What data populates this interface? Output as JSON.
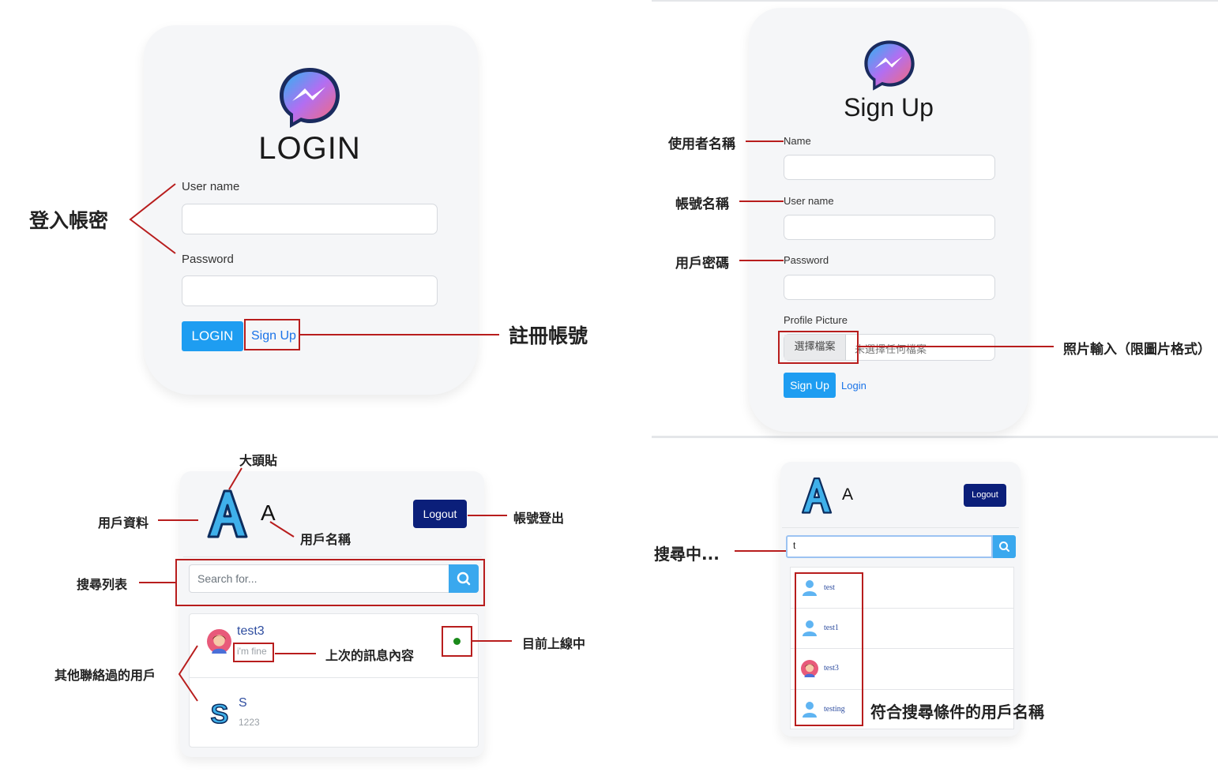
{
  "login": {
    "title": "LOGIN",
    "username_label": "User name",
    "password_label": "Password",
    "login_button": "LOGIN",
    "signup_link": "Sign Up"
  },
  "signup": {
    "title": "Sign Up",
    "name_label": "Name",
    "username_label": "User name",
    "password_label": "Password",
    "picture_label": "Profile Picture",
    "file_button": "選擇檔案",
    "file_status": "未選擇任何檔案",
    "signup_button": "Sign Up",
    "login_link": "Login"
  },
  "chat": {
    "avatar_letter": "A",
    "user_name": "A",
    "logout_button": "Logout",
    "search_placeholder": "Search for...",
    "contacts": [
      {
        "name": "test3",
        "last_message": "i'm fine",
        "avatar": "female-avatar"
      },
      {
        "name": "S",
        "last_message": "1223",
        "avatar": "letter-s"
      }
    ],
    "online_color": "#1a8a1a"
  },
  "search": {
    "avatar_letter": "A",
    "user_name": "A",
    "logout_button": "Logout",
    "query": "t",
    "results": [
      {
        "name": "test",
        "avatar": "person-icon"
      },
      {
        "name": "test1",
        "avatar": "person-icon"
      },
      {
        "name": "test3",
        "avatar": "female-avatar"
      },
      {
        "name": "testing",
        "avatar": "person-icon"
      }
    ]
  },
  "annotations": {
    "login_account": "登入帳密",
    "register_account": "註冊帳號",
    "username_name": "使用者名稱",
    "account_name": "帳號名稱",
    "user_password": "用戶密碼",
    "photo_input": "照片輸入（限圖片格式）",
    "profile_picture": "大頭貼",
    "user_profile": "用戶資料",
    "user_name": "用戶名稱",
    "logout": "帳號登出",
    "search_list": "搜尋列表",
    "last_message": "上次的訊息內容",
    "online_now": "目前上線中",
    "other_contacts": "其他聯絡過的用戶",
    "searching": "搜尋中...",
    "matching_users": "符合搜尋條件的用戶名稱"
  },
  "colors": {
    "primary_blue": "#1e9df1",
    "navy": "#0b1f7a",
    "annotation_red": "#b81d1d",
    "online_green": "#1a8a1a"
  }
}
